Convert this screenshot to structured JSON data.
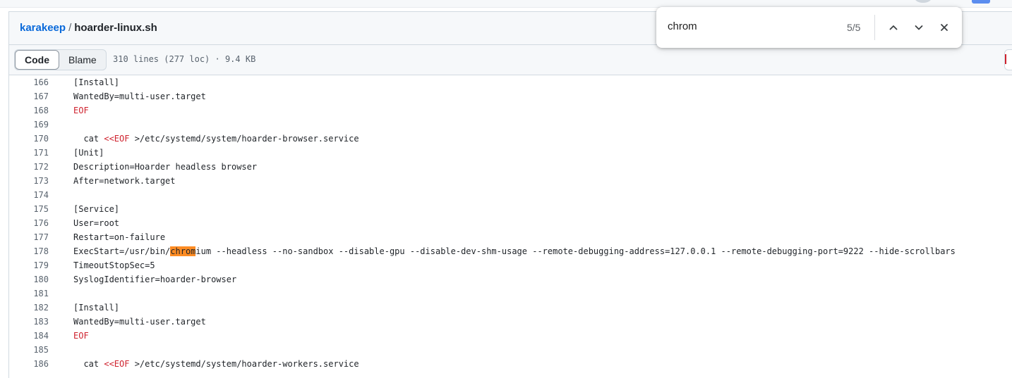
{
  "breadcrumb": {
    "repo": "karakeep",
    "separator": "/",
    "file": "hoarder-linux.sh"
  },
  "tabs": {
    "code": "Code",
    "blame": "Blame"
  },
  "file_meta": "310 lines (277 loc) · 9.4 KB",
  "find": {
    "query": "chrom",
    "count": "5/5"
  },
  "lines": [
    {
      "n": "166",
      "parts": [
        {
          "t": "[Install]"
        }
      ]
    },
    {
      "n": "167",
      "parts": [
        {
          "t": "WantedBy=multi-user.target"
        }
      ]
    },
    {
      "n": "168",
      "parts": [
        {
          "t": "EOF",
          "c": "kw"
        }
      ]
    },
    {
      "n": "169",
      "parts": []
    },
    {
      "n": "170",
      "parts": [
        {
          "t": "  cat "
        },
        {
          "t": "<<EOF",
          "c": "kw"
        },
        {
          "t": " >/etc/systemd/system/hoarder-browser.service"
        }
      ]
    },
    {
      "n": "171",
      "parts": [
        {
          "t": "[Unit]"
        }
      ]
    },
    {
      "n": "172",
      "parts": [
        {
          "t": "Description=Hoarder headless browser"
        }
      ]
    },
    {
      "n": "173",
      "parts": [
        {
          "t": "After=network.target"
        }
      ]
    },
    {
      "n": "174",
      "parts": []
    },
    {
      "n": "175",
      "parts": [
        {
          "t": "[Service]"
        }
      ]
    },
    {
      "n": "176",
      "parts": [
        {
          "t": "User=root"
        }
      ]
    },
    {
      "n": "177",
      "parts": [
        {
          "t": "Restart=on-failure"
        }
      ]
    },
    {
      "n": "178",
      "parts": [
        {
          "t": "ExecStart=/usr/bin/"
        },
        {
          "t": "chrom",
          "c": "hl"
        },
        {
          "t": "ium --headless --no-sandbox --disable-gpu --disable-dev-shm-usage --remote-debugging-address=127.0.0.1 --remote-debugging-port=9222 --hide-scrollbars"
        }
      ]
    },
    {
      "n": "179",
      "parts": [
        {
          "t": "TimeoutStopSec=5"
        }
      ]
    },
    {
      "n": "180",
      "parts": [
        {
          "t": "SyslogIdentifier=hoarder-browser"
        }
      ]
    },
    {
      "n": "181",
      "parts": []
    },
    {
      "n": "182",
      "parts": [
        {
          "t": "[Install]"
        }
      ]
    },
    {
      "n": "183",
      "parts": [
        {
          "t": "WantedBy=multi-user.target"
        }
      ]
    },
    {
      "n": "184",
      "parts": [
        {
          "t": "EOF",
          "c": "kw"
        }
      ]
    },
    {
      "n": "185",
      "parts": []
    },
    {
      "n": "186",
      "parts": [
        {
          "t": "  cat "
        },
        {
          "t": "<<EOF",
          "c": "kw"
        },
        {
          "t": " >/etc/systemd/system/hoarder-workers.service"
        }
      ]
    }
  ],
  "colors": {
    "link": "#0969da",
    "keyword": "#cf222e",
    "highlight": "#fd8c24"
  },
  "icons": {
    "prev": "chevron-up-icon",
    "next": "chevron-down-icon",
    "close": "close-icon"
  }
}
